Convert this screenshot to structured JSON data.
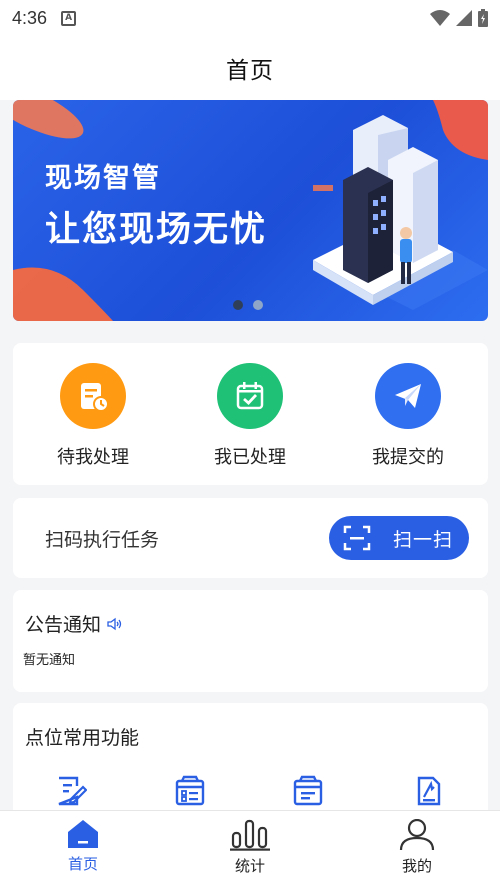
{
  "status_bar": {
    "time": "4:36",
    "notification_letter": "A"
  },
  "header": {
    "title": "首页"
  },
  "banner": {
    "line1": "现场智管",
    "line2": "让您现场无忧",
    "slide_count": 2,
    "active_slide": 1
  },
  "quick_actions": [
    {
      "label": "待我处理",
      "icon": "pending-document-icon",
      "color": "#ff9a12"
    },
    {
      "label": "我已处理",
      "icon": "calendar-check-icon",
      "color": "#1ec176"
    },
    {
      "label": "我提交的",
      "icon": "paper-plane-icon",
      "color": "#2f6ff0"
    }
  ],
  "scan": {
    "label": "扫码执行任务",
    "button_label": "扫一扫"
  },
  "notice": {
    "title": "公告通知",
    "empty_text": "暂无通知"
  },
  "functions": {
    "title": "点位常用功能"
  },
  "bottom_nav": [
    {
      "label": "首页",
      "icon": "home-icon"
    },
    {
      "label": "统计",
      "icon": "bar-chart-icon"
    },
    {
      "label": "我的",
      "icon": "user-icon"
    }
  ],
  "colors": {
    "accent": "#2a5fe3",
    "background": "#f4f5f7"
  }
}
